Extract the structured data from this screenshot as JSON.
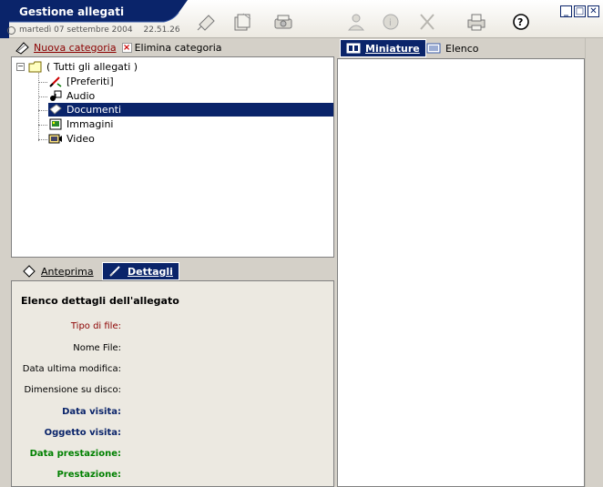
{
  "titlebar": {
    "title": "Gestione allegati",
    "date": "martedì 07 settembre 2004",
    "time": "22.51.26",
    "icons": [
      "edit-document-icon",
      "new-document-icon",
      "scanner-icon",
      "user-icon",
      "info-icon",
      "close-x-icon",
      "print-icon",
      "help-icon"
    ],
    "window_controls": [
      "minimize",
      "maximize",
      "close"
    ]
  },
  "left_toolbar": {
    "new_category": "Nuova categoria",
    "delete_category": "Elimina categoria"
  },
  "tree": {
    "root": "( Tutti gli allegati )",
    "items": [
      "[Preferiti]",
      "Audio",
      "Documenti",
      "Immagini",
      "Video"
    ],
    "selected": "Documenti"
  },
  "left_tabs": {
    "preview": "Anteprima",
    "details": "Dettagli"
  },
  "details": {
    "heading": "Elenco dettagli dell'allegato",
    "labels": {
      "file_type": "Tipo di file:",
      "file_name": "Nome File:",
      "last_modified": "Data ultima modifica:",
      "disk_size": "Dimensione su disco:",
      "visit_date": "Data visita:",
      "visit_subject": "Oggetto visita:",
      "service_date": "Data prestazione:",
      "service": "Prestazione:"
    }
  },
  "right_tabs": {
    "thumbnails": "Miniature",
    "list": "Elenco"
  },
  "colors": {
    "selection": "#0a246a",
    "label_red": "#8b0000",
    "label_blue": "#0a246a",
    "label_green": "#008000"
  }
}
